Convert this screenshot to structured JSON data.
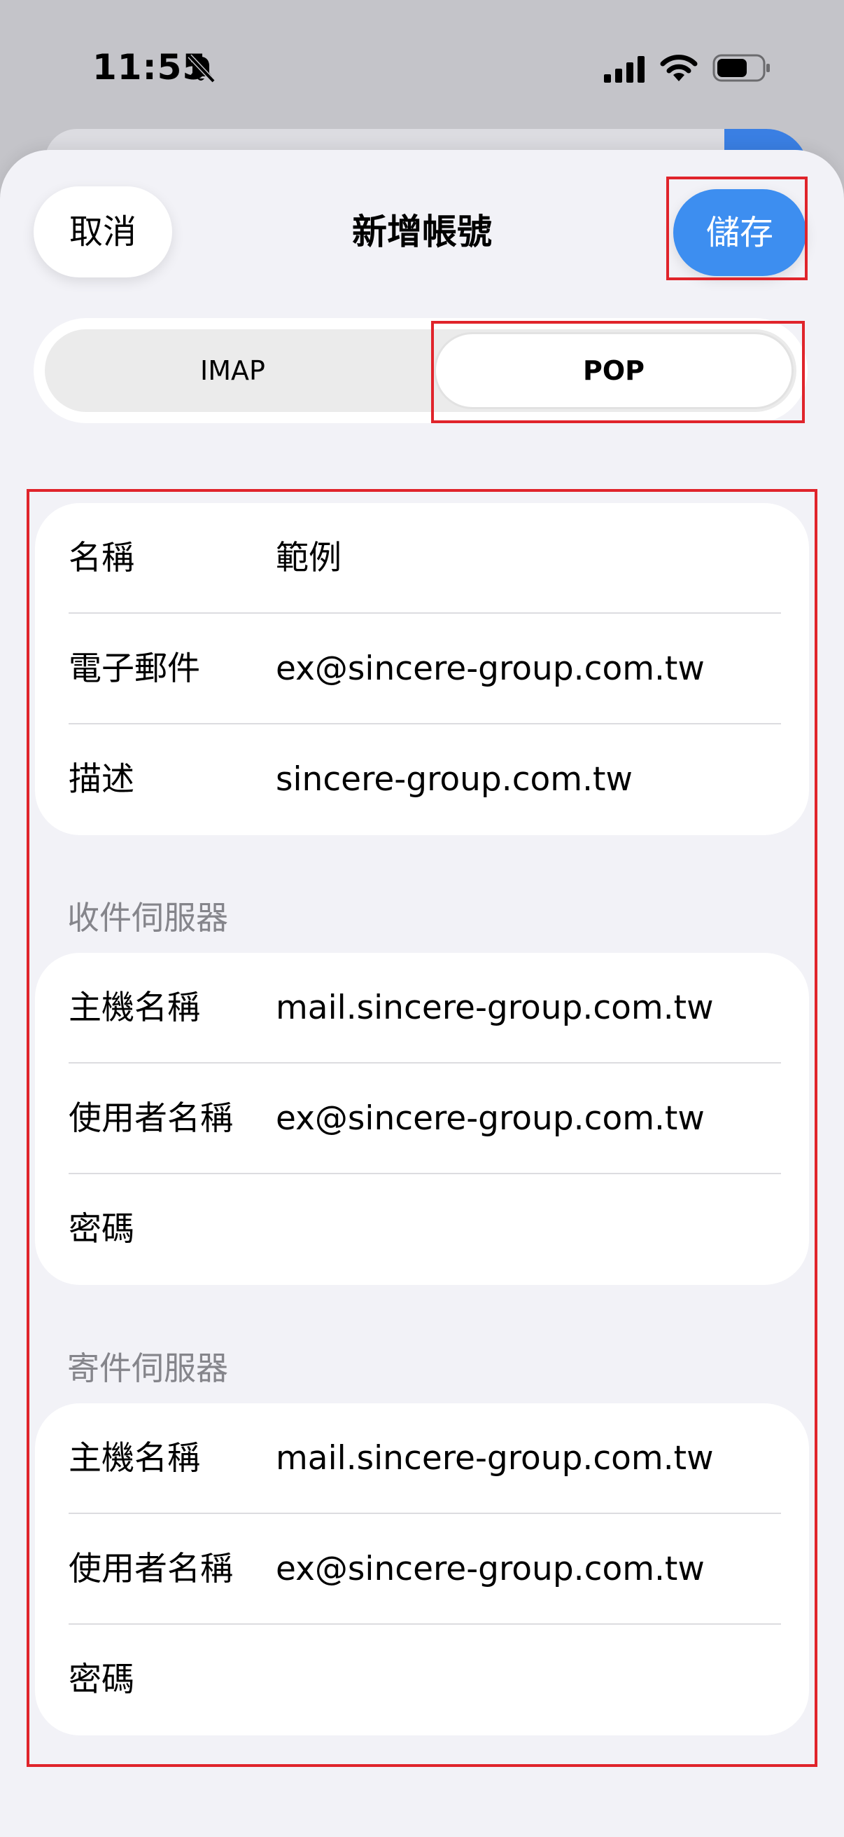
{
  "status_bar": {
    "time": "11:55"
  },
  "nav": {
    "cancel_label": "取消",
    "title": "新增帳號",
    "save_label": "儲存"
  },
  "segmented": {
    "options": [
      "IMAP",
      "POP"
    ],
    "selected": "POP"
  },
  "account_group": {
    "rows": [
      {
        "label": "名稱",
        "value": "範例"
      },
      {
        "label": "電子郵件",
        "value": "ex@sincere-group.com.tw"
      },
      {
        "label": "描述",
        "value": "sincere-group.com.tw"
      }
    ]
  },
  "incoming": {
    "header": "收件伺服器",
    "rows": [
      {
        "label": "主機名稱",
        "value": "mail.sincere-group.com.tw"
      },
      {
        "label": "使用者名稱",
        "value": "ex@sincere-group.com.tw"
      },
      {
        "label": "密碼",
        "value": ""
      }
    ]
  },
  "outgoing": {
    "header": "寄件伺服器",
    "rows": [
      {
        "label": "主機名稱",
        "value": "mail.sincere-group.com.tw"
      },
      {
        "label": "使用者名稱",
        "value": "ex@sincere-group.com.tw"
      },
      {
        "label": "密碼",
        "value": ""
      }
    ]
  },
  "colors": {
    "accent_blue": "#3d8ef0",
    "highlight_red": "#e0242b",
    "background": "#f2f2f7"
  }
}
